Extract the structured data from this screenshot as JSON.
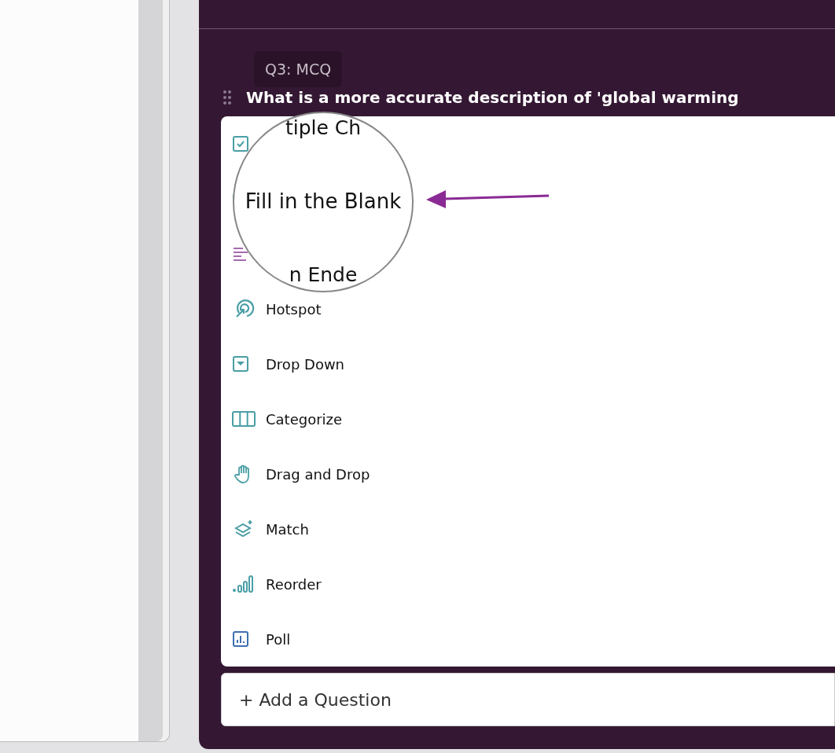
{
  "question": {
    "badge": "Q3: MCQ",
    "text": "What is a more accurate description of 'global warming"
  },
  "menu": {
    "items": [
      {
        "kind": "checkbox"
      },
      {
        "kind": "blank"
      },
      {
        "kind": "lines"
      },
      {
        "kind": "hotspot",
        "label": "Hotspot"
      },
      {
        "kind": "dropdown",
        "label": "Drop Down"
      },
      {
        "kind": "columns",
        "label": "Categorize"
      },
      {
        "kind": "hand",
        "label": "Drag and Drop"
      },
      {
        "kind": "layers",
        "label": "Match"
      },
      {
        "kind": "bars",
        "label": "Reorder"
      },
      {
        "kind": "poll",
        "label": "Poll"
      }
    ]
  },
  "magnifier": {
    "lines": [
      "tiple Ch",
      "Fill in the Blank",
      "n Ende"
    ]
  },
  "add_button": {
    "label": "+ Add a Question"
  }
}
